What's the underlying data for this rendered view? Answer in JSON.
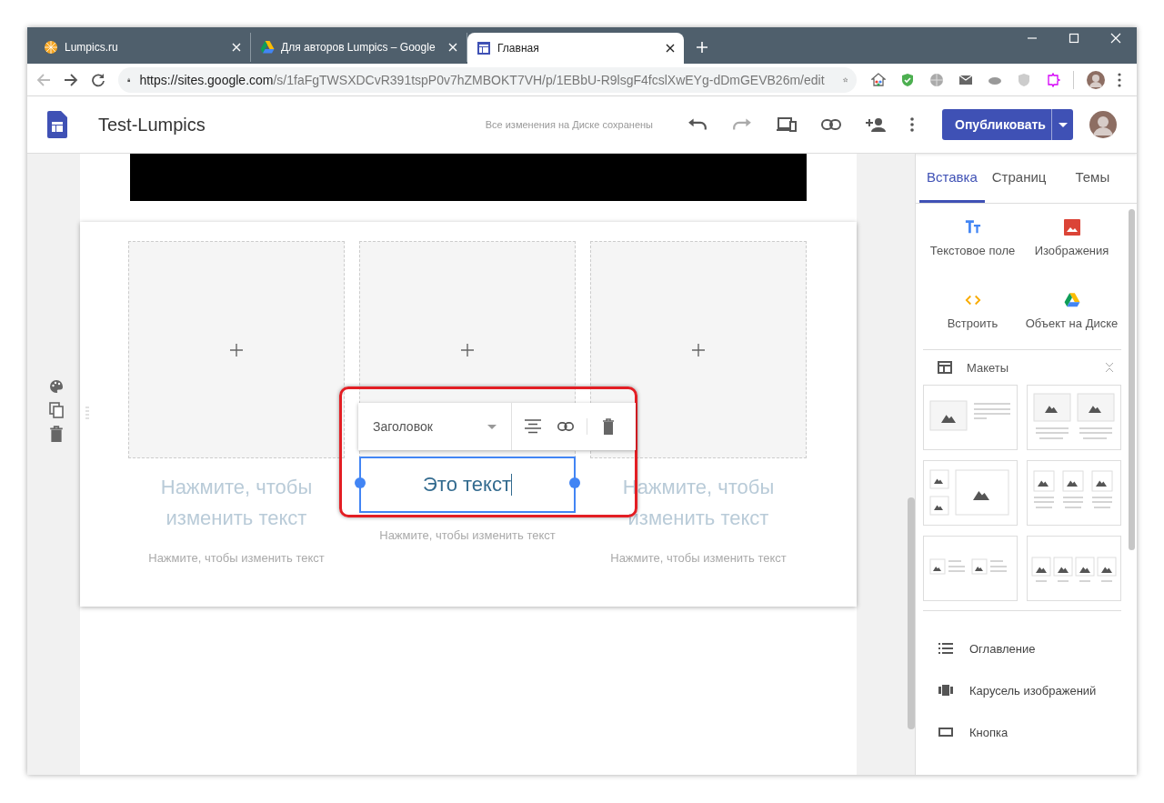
{
  "browser": {
    "tabs": [
      {
        "title": "Lumpics.ru",
        "kind": "orange",
        "selected": false
      },
      {
        "title": "Для авторов Lumpics – Google",
        "kind": "drive",
        "selected": false
      },
      {
        "title": "Главная",
        "kind": "sites",
        "selected": true
      }
    ],
    "url_host": "https://sites.google.com",
    "url_path": "/s/1faFgTWSXDCvR391tspP0v7hZMBOKT7VH/p/1EBbU-R9lsgF4fcslXwEYg-dDmGEVB26m/edit"
  },
  "app": {
    "site_title": "Test-Lumpics",
    "save_status": "Все изменения на Диске сохранены",
    "publish_label": "Опубликовать"
  },
  "editor": {
    "toolbar_style": "Заголовок",
    "columns": [
      {
        "heading": "Нажмите, чтобы изменить текст",
        "body": "Нажмите, чтобы изменить текст",
        "editing": false
      },
      {
        "heading": "Это текст",
        "body": "Нажмите, чтобы изменить текст",
        "editing": true
      },
      {
        "heading": "Нажмите, чтобы изменить текст",
        "body": "Нажмите, чтобы изменить текст",
        "editing": false
      }
    ]
  },
  "panel": {
    "tabs": [
      {
        "label": "Вставка",
        "selected": true
      },
      {
        "label": "Страниц",
        "selected": false
      },
      {
        "label": "Темы",
        "selected": false
      }
    ],
    "insert_items": [
      {
        "label": "Текстовое поле",
        "kind": "text"
      },
      {
        "label": "Изображения",
        "kind": "image"
      },
      {
        "label": "Встроить",
        "kind": "embed"
      },
      {
        "label": "Объект на Диске",
        "kind": "drive"
      }
    ],
    "layouts_label": "Макеты",
    "layouts": [
      {
        "kind": "image-text"
      },
      {
        "kind": "two-images"
      },
      {
        "kind": "mosaic"
      },
      {
        "kind": "three-images"
      },
      {
        "kind": "two-image-text"
      },
      {
        "kind": "four-images"
      }
    ],
    "components": [
      {
        "label": "Оглавление",
        "kind": "toc"
      },
      {
        "label": "Карусель изображений",
        "kind": "carousel"
      },
      {
        "label": "Кнопка",
        "kind": "button"
      }
    ]
  }
}
